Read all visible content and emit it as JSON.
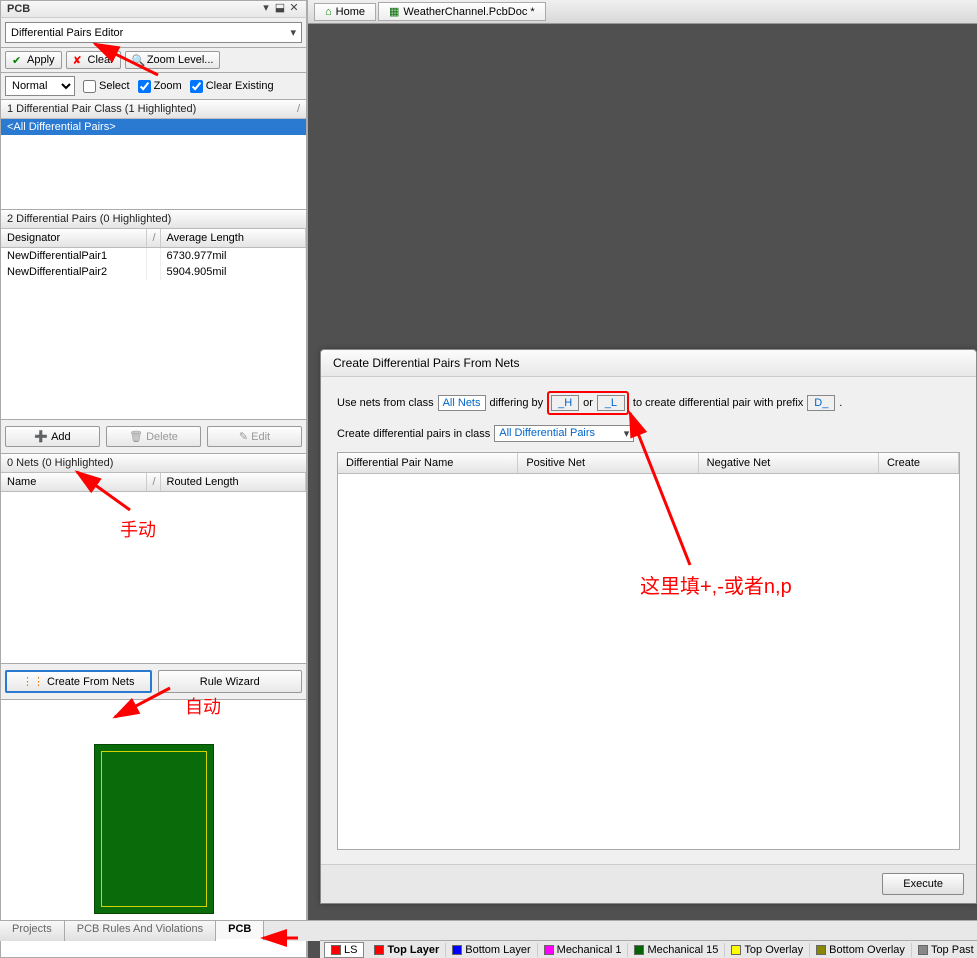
{
  "panel": {
    "title": "PCB",
    "mode": "Differential Pairs Editor",
    "apply": "Apply",
    "clear": "Clear",
    "zoom_level": "Zoom Level...",
    "normal": "Normal",
    "select_cb": "Select",
    "zoom_cb": "Zoom",
    "clear_existing_cb": "Clear Existing"
  },
  "class_list": {
    "header": "1 Differential Pair Class (1 Highlighted)",
    "selected": "<All Differential Pairs>"
  },
  "pairs_list": {
    "header": "2 Differential Pairs (0 Highlighted)",
    "col_designator": "Designator",
    "col_divider": "/",
    "col_avg": "Average Length",
    "rows": [
      {
        "designator": "NewDifferentialPair1",
        "length": "6730.977mil"
      },
      {
        "designator": "NewDifferentialPair2",
        "length": "5904.905mil"
      }
    ]
  },
  "pair_btns": {
    "add": "Add",
    "delete": "Delete",
    "edit": "Edit"
  },
  "nets_list": {
    "header": "0 Nets (0 Highlighted)",
    "col_name": "Name",
    "col_divider": "/",
    "col_routed": "Routed Length"
  },
  "net_btns": {
    "create": "Create From Nets",
    "wizard": "Rule Wizard"
  },
  "bottom_tabs": {
    "projects": "Projects",
    "rules": "PCB Rules And Violations",
    "pcb": "PCB"
  },
  "top_tabs": {
    "home": "Home",
    "doc": "WeatherChannel.PcbDoc *"
  },
  "dialog": {
    "title": "Create Differential Pairs From Nets",
    "label_use": "Use nets from class",
    "class_value": "All Nets",
    "label_diff": "differing by",
    "suffix1": "_H",
    "label_or": "or",
    "suffix2": "_L",
    "label_to_create": "to create differential pair with prefix",
    "prefix": "D_",
    "dot": ".",
    "label_create_in": "Create differential pairs in class",
    "target_class": "All Differential Pairs",
    "col_pair": "Differential Pair Name",
    "col_pos": "Positive Net",
    "col_neg": "Negative Net",
    "col_create": "Create",
    "execute": "Execute"
  },
  "layers": {
    "ls": "LS",
    "top": "Top Layer",
    "bottom": "Bottom Layer",
    "mech1": "Mechanical 1",
    "mech15": "Mechanical 15",
    "top_overlay": "Top Overlay",
    "bottom_overlay": "Bottom Overlay",
    "top_paste": "Top Past"
  },
  "annotations": {
    "manual": "手动",
    "auto": "自动",
    "fill_hint": "这里填+,-或者n,p"
  }
}
